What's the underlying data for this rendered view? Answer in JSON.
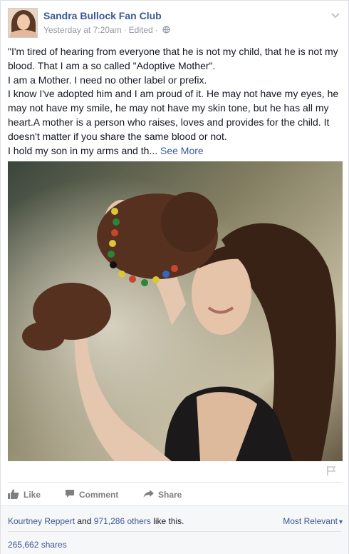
{
  "post": {
    "page_name": "Sandra Bullock Fan Club",
    "timestamp": "Yesterday at 7:20am",
    "separator": "·",
    "edited_label": "Edited",
    "privacy_icon": "globe-icon",
    "menu_icon": "chevron-down-icon",
    "text_lines": [
      "\"I'm tired of hearing from everyone that he is not my child, that he is not my blood. That I am a so called \"Adoptive Mother\".",
      "I am a Mother. I need no other label or prefix.",
      "I know I've adopted him and I am proud of it. He may not have my eyes, he may not have my smile, he may not have my skin tone, but he has all my heart.A mother is a person who raises, loves and provides for the child. It doesn't matter if you share the same blood or not.",
      "I hold my son in my arms and th..."
    ],
    "see_more_label": "See More",
    "save_icon": "flag-icon"
  },
  "actions": {
    "like_label": "Like",
    "comment_label": "Comment",
    "share_label": "Share"
  },
  "summary": {
    "liker_name": "Kourtney Reppert",
    "and_text": " and ",
    "others_link": "971,286 others",
    "like_suffix": " like this.",
    "sort_label": "Most Relevant",
    "sort_caret": "▾",
    "shares_text": "265,662 shares"
  },
  "colors": {
    "link_blue": "#3b5998",
    "meta_gray": "#9197a3",
    "action_gray": "#7f7f7f",
    "summary_bg": "#f6f7f9"
  }
}
